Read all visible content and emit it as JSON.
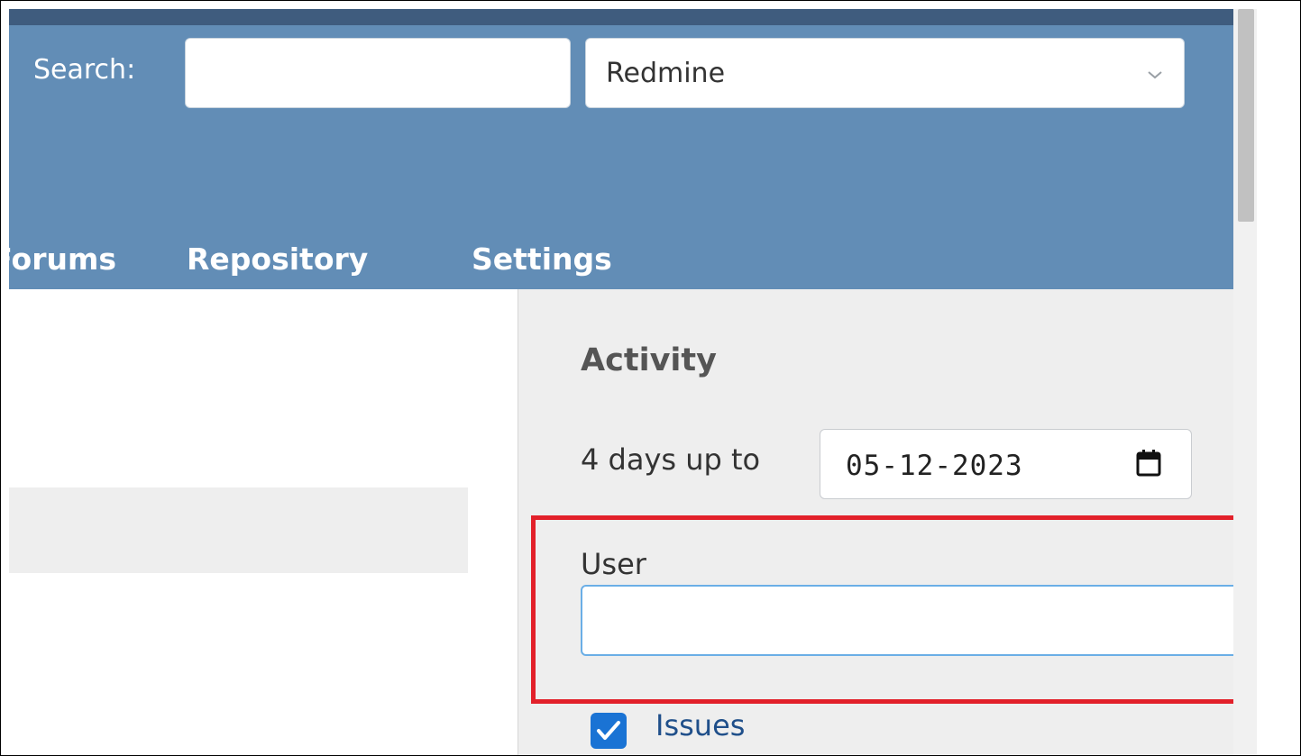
{
  "header": {
    "search_label": "Search:",
    "search_value": "",
    "project_select_value": "Redmine"
  },
  "menu": {
    "items": [
      "Forums",
      "Repository",
      "Settings"
    ]
  },
  "sidebar": {
    "title": "Activity",
    "days_label": "4 days up to",
    "date_value": "05-12-2023",
    "user_label": "User",
    "user_value": "",
    "filters": [
      {
        "label": "Issues",
        "checked": true
      }
    ]
  },
  "colors": {
    "header_bg": "#628db6",
    "top_strip": "#3f5c7e",
    "sidebar_bg": "#eeeeee",
    "highlight": "#e2202a",
    "checkbox": "#1a73d4",
    "link": "#1f4f8a"
  }
}
